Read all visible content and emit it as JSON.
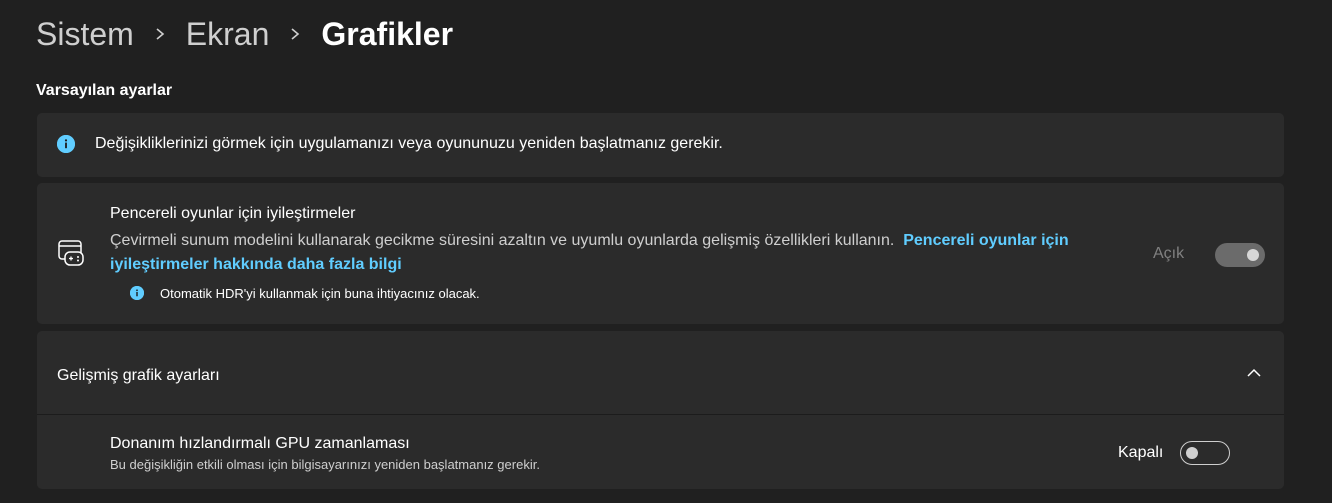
{
  "breadcrumb": {
    "items": [
      "Sistem",
      "Ekran"
    ],
    "current": "Grafikler"
  },
  "section": {
    "title": "Varsayılan ayarlar"
  },
  "info_banner": {
    "icon": "info-icon",
    "text": "Değişikliklerinizi görmek için uygulamanızı veya oyununuzu yeniden başlatmanız gerekir."
  },
  "windowed_games": {
    "icon": "gamepad-icon",
    "title": "Pencereli oyunlar için iyileştirmeler",
    "description": "Çevirmeli sunum modelini kullanarak gecikme süresini azaltın ve uyumlu oyunlarda gelişmiş özellikleri kullanın.",
    "link": "Pencereli oyunlar için iyileştirmeler hakkında daha fazla bilgi",
    "note": "Otomatik HDR'yi kullanmak için buna ihtiyacınız olacak.",
    "toggle_label": "Açık",
    "toggle_state": true,
    "toggle_disabled": true
  },
  "advanced": {
    "title": "Gelişmiş grafik ayarları",
    "expanded": true,
    "gpu_scheduling": {
      "title": "Donanım hızlandırmalı GPU zamanlaması",
      "description": "Bu değişikliğin etkili olması için bilgisayarınızı yeniden başlatmanız gerekir.",
      "toggle_label": "Kapalı",
      "toggle_state": false
    }
  },
  "colors": {
    "background": "#202020",
    "card": "#2b2b2b",
    "accent": "#60cdff"
  }
}
